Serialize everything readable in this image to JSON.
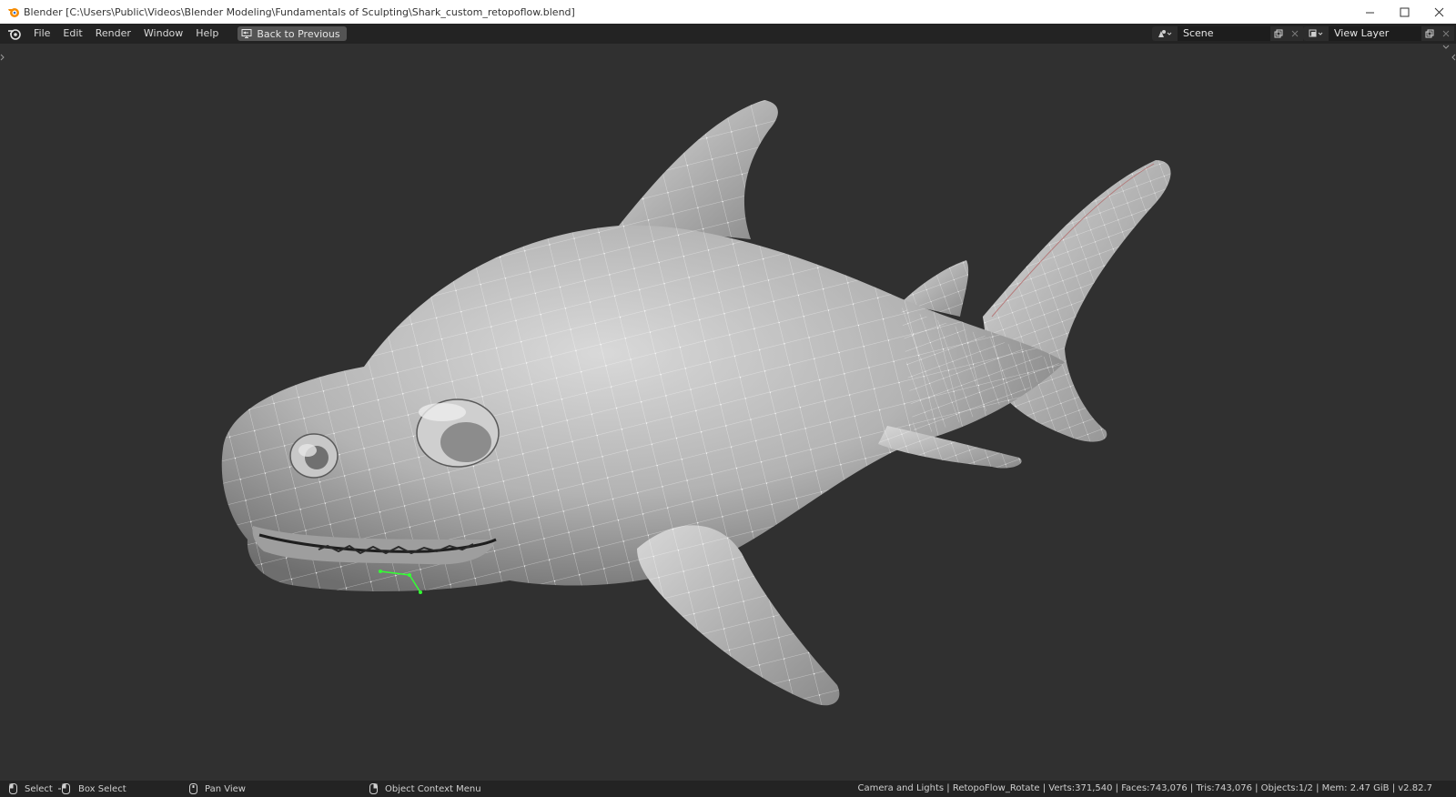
{
  "window": {
    "title": "Blender [C:\\Users\\Public\\Videos\\Blender Modeling\\Fundamentals of Sculpting\\Shark_custom_retopoflow.blend]",
    "controls": [
      "minimize-icon",
      "maximize-icon",
      "close-icon"
    ]
  },
  "menubar": {
    "items": [
      "File",
      "Edit",
      "Render",
      "Window",
      "Help"
    ],
    "back_button": "Back to Previous"
  },
  "scene": {
    "name": "Scene"
  },
  "view_layer": {
    "name": "View Layer"
  },
  "statusbar": {
    "hints": [
      {
        "icon": "mouse-left-icon",
        "label": "Select"
      },
      {
        "icon": "mouse-left-drag-icon",
        "label": "Box Select"
      },
      {
        "icon": "mouse-middle-icon",
        "label": "Pan View"
      },
      {
        "icon": "mouse-right-icon",
        "label": "Object Context Menu"
      }
    ],
    "stats": "Camera and Lights | RetopoFlow_Rotate | Verts:371,540 | Faces:743,076 | Tris:743,076 | Objects:1/2 | Mem: 2.47 GiB | v2.82.7"
  },
  "colors": {
    "viewport_bg": "#303030",
    "header_bg": "#232323",
    "accent_selection": "#33ff33",
    "mesh": "#bdbdbd"
  }
}
